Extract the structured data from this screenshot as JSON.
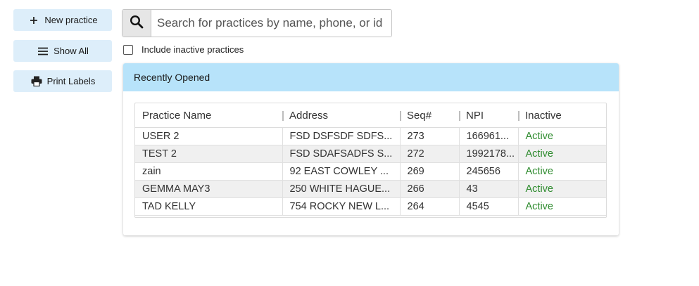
{
  "sidebar": {
    "new_practice": "New practice",
    "show_all": "Show All",
    "print_labels": "Print Labels"
  },
  "search": {
    "placeholder": "Search for practices by name, phone, or id",
    "value": ""
  },
  "include_inactive": {
    "label": "Include inactive practices",
    "checked": false
  },
  "recent": {
    "title": "Recently Opened",
    "columns": [
      "Practice Name",
      "Address",
      "Seq#",
      "NPI",
      "Inactive"
    ],
    "rows": [
      [
        "USER 2",
        "FSD DSFSDF SDFS...",
        "273",
        "166961...",
        "Active"
      ],
      [
        "TEST 2",
        "FSD SDAFSADFS S...",
        "272",
        "1992178...",
        "Active"
      ],
      [
        "zain",
        "92 EAST COWLEY ...",
        "269",
        "245656",
        "Active"
      ],
      [
        "GEMMA MAY3",
        "250 WHITE HAGUE...",
        "266",
        "43",
        "Active"
      ],
      [
        "TAD KELLY",
        "754 ROCKY NEW L...",
        "264",
        "4545",
        "Active"
      ]
    ]
  },
  "colors": {
    "button_bg": "#ddeefa",
    "panel_header_bg": "#b7e3fa",
    "status_active": "#2e8b2e"
  }
}
